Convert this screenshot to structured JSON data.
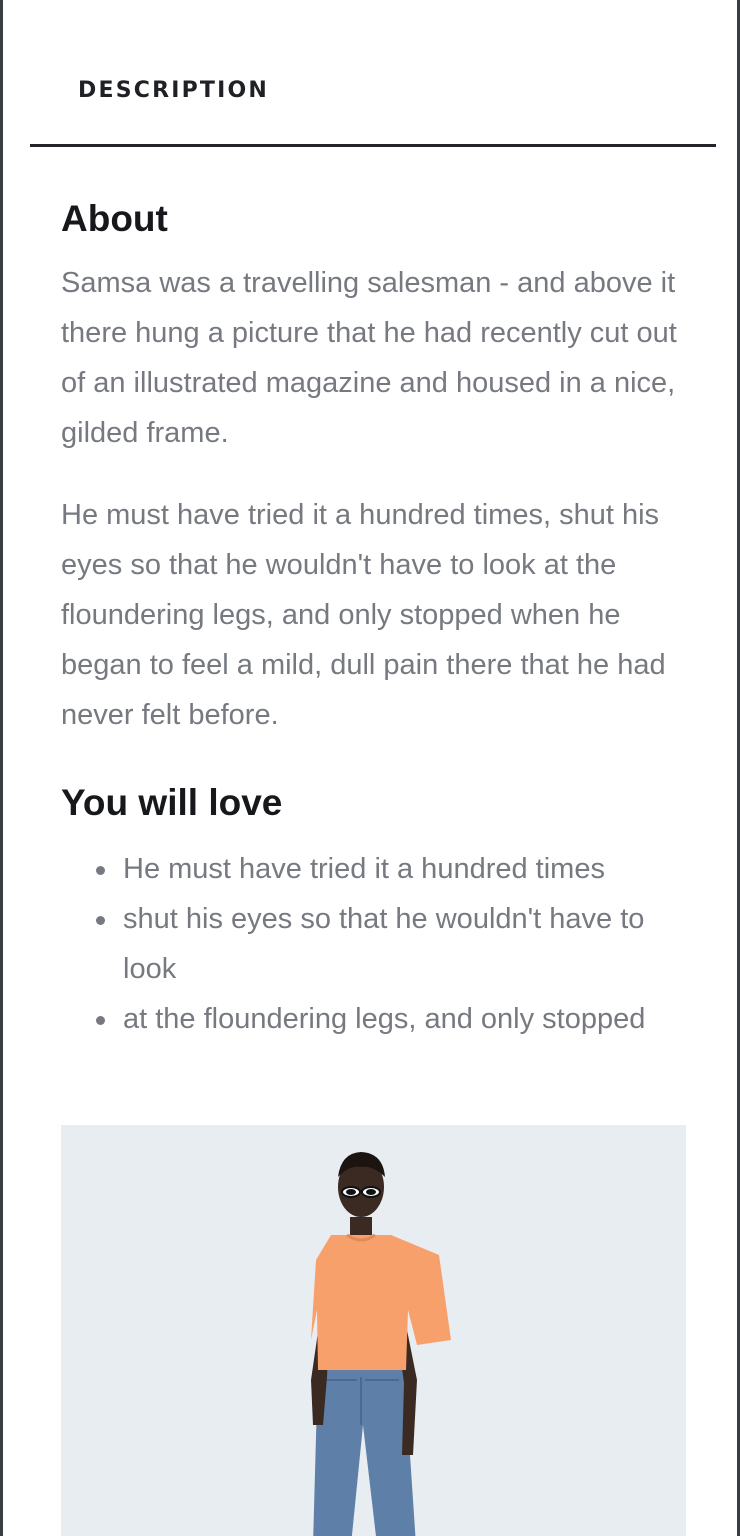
{
  "tabs": {
    "active_label": "DESCRIPTION"
  },
  "about": {
    "heading": "About",
    "paragraphs": [
      "Samsa was a travelling salesman - and above it there hung a picture that he had recently cut out of an illustrated magazine and housed in a nice, gilded frame.",
      "He must have tried it a hundred times, shut his eyes so that he wouldn't have to look at the floundering legs, and only stopped when he began to feel a mild, dull pain there that he had never felt before."
    ]
  },
  "love": {
    "heading": "You will love",
    "items": [
      "He must have tried it a hundred times",
      "shut his eyes so that he wouldn't have to look",
      "at the floundering legs, and only stopped"
    ]
  },
  "colors": {
    "heading": "#16181c",
    "body_text": "#767a80",
    "divider": "#222429",
    "image_background": "#e8edf1",
    "shirt": "#f7a06c",
    "jeans": "#5e7fa8"
  }
}
